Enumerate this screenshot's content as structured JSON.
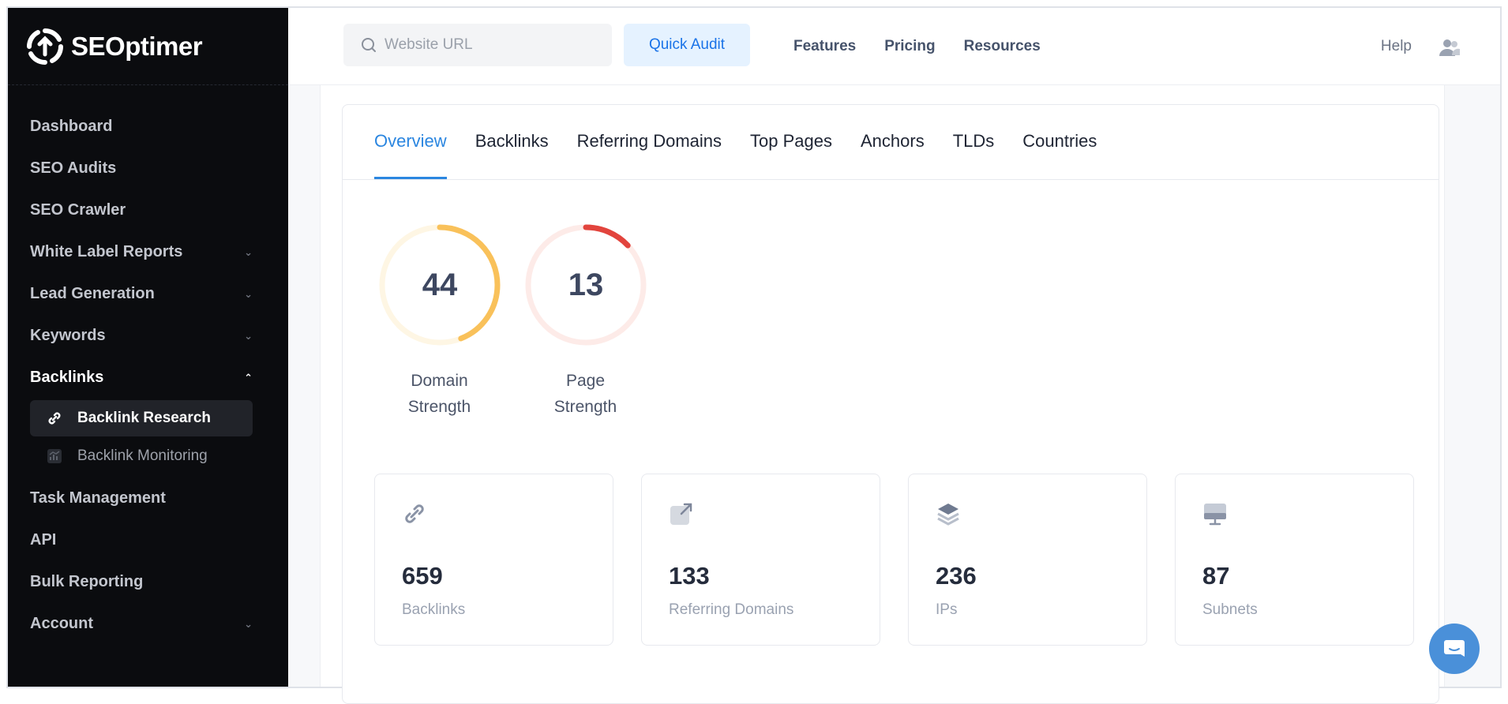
{
  "app": {
    "logo_text": "SEOptimer"
  },
  "sidebar": {
    "items": [
      {
        "label": "Dashboard"
      },
      {
        "label": "SEO Audits"
      },
      {
        "label": "SEO Crawler"
      },
      {
        "label": "White Label Reports"
      },
      {
        "label": "Lead Generation"
      },
      {
        "label": "Keywords"
      },
      {
        "label": "Backlinks"
      },
      {
        "label": "Task Management"
      },
      {
        "label": "API"
      },
      {
        "label": "Bulk Reporting"
      },
      {
        "label": "Account"
      }
    ],
    "sub_items": [
      {
        "label": "Backlink Research"
      },
      {
        "label": "Backlink Monitoring"
      }
    ]
  },
  "topbar": {
    "search_placeholder": "Website URL",
    "quick_audit_label": "Quick Audit",
    "nav": [
      "Features",
      "Pricing",
      "Resources"
    ],
    "help_label": "Help"
  },
  "tabs": [
    "Overview",
    "Backlinks",
    "Referring Domains",
    "Top Pages",
    "Anchors",
    "TLDs",
    "Countries"
  ],
  "gauges": [
    {
      "value": "44",
      "score": 44,
      "label_line1": "Domain",
      "label_line2": "Strength",
      "color": "#f9c15a",
      "track": "#fef6e4"
    },
    {
      "value": "13",
      "score": 13,
      "label_line1": "Page",
      "label_line2": "Strength",
      "color": "#e2443d",
      "track": "#fdebe8"
    }
  ],
  "stats": [
    {
      "value": "659",
      "label": "Backlinks",
      "icon": "link-icon"
    },
    {
      "value": "133",
      "label": "Referring Domains",
      "icon": "external-link-icon"
    },
    {
      "value": "236",
      "label": "IPs",
      "icon": "layers-icon"
    },
    {
      "value": "87",
      "label": "Subnets",
      "icon": "monitor-icon"
    }
  ],
  "colors": {
    "accent": "#2b86e0",
    "sidebar_bg": "#0b0c0f",
    "chat_bg": "#4a90d9"
  }
}
